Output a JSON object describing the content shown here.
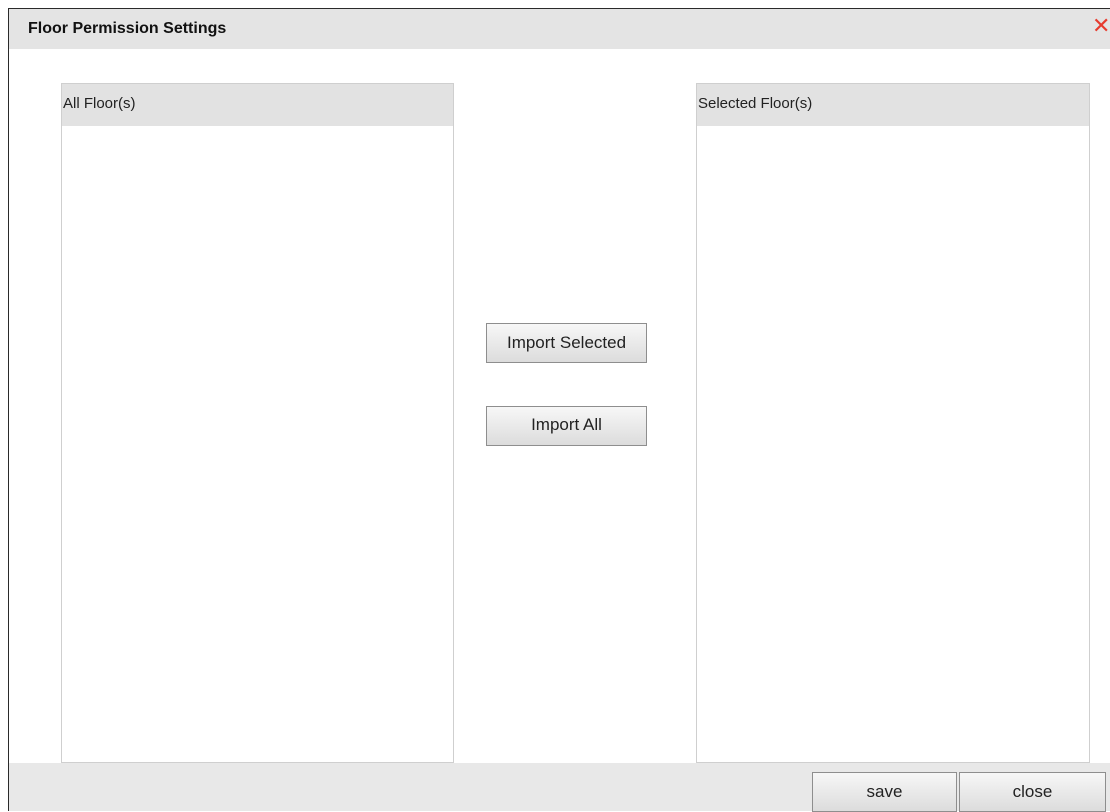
{
  "dialog": {
    "title": "Floor Permission Settings",
    "close_icon": "close-x-icon",
    "close_icon_color": "#e63b2e"
  },
  "lists": {
    "all": {
      "header": "All Floor(s)",
      "items": []
    },
    "selected": {
      "header": "Selected Floor(s)",
      "items": []
    }
  },
  "actions": {
    "import_selected": "Import Selected",
    "import_all": "Import All"
  },
  "footer": {
    "save": "save",
    "close": "close"
  }
}
